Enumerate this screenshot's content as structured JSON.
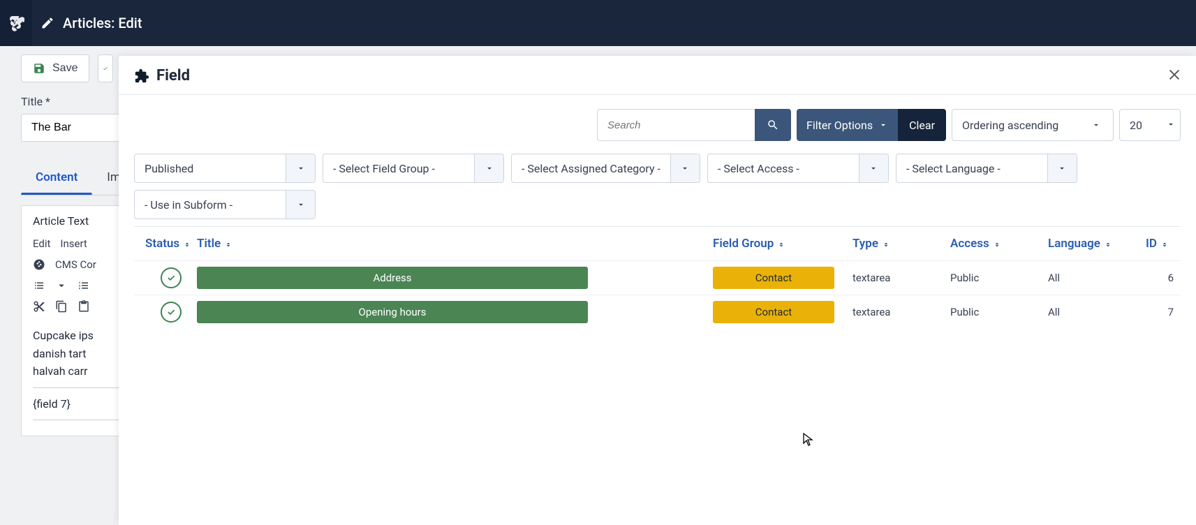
{
  "header": {
    "page_title": "Articles: Edit"
  },
  "toolbar": {
    "save_label": "Save"
  },
  "form": {
    "title_label": "Title *",
    "title_value": "The Bar"
  },
  "tabs": [
    {
      "label": "Content",
      "active": true
    },
    {
      "label": "Imag",
      "active": false
    }
  ],
  "editor": {
    "label": "Article Text",
    "menu": [
      "Edit",
      "Insert"
    ],
    "cms_label": "CMS Cor",
    "body_lines": [
      "Cupcake ips",
      "danish tart ",
      "halvah carr"
    ],
    "shortcode": "{field 7}"
  },
  "modal": {
    "title": "Field",
    "search_placeholder": "Search",
    "filter_options_label": "Filter Options",
    "clear_label": "Clear",
    "order_label": "Ordering ascending",
    "limit_label": "20",
    "filters": {
      "state": "Published",
      "group": "- Select Field Group -",
      "category": "- Select Assigned Category -",
      "access": "- Select Access -",
      "language": "- Select Language -",
      "subform": "- Use in Subform -"
    },
    "columns": {
      "status": "Status",
      "title": "Title",
      "group": "Field Group",
      "type": "Type",
      "access": "Access",
      "language": "Language",
      "id": "ID"
    },
    "rows": [
      {
        "title": "Address",
        "group": "Contact",
        "type": "textarea",
        "access": "Public",
        "language": "All",
        "id": "6"
      },
      {
        "title": "Opening hours",
        "group": "Contact",
        "type": "textarea",
        "access": "Public",
        "language": "All",
        "id": "7"
      }
    ]
  }
}
